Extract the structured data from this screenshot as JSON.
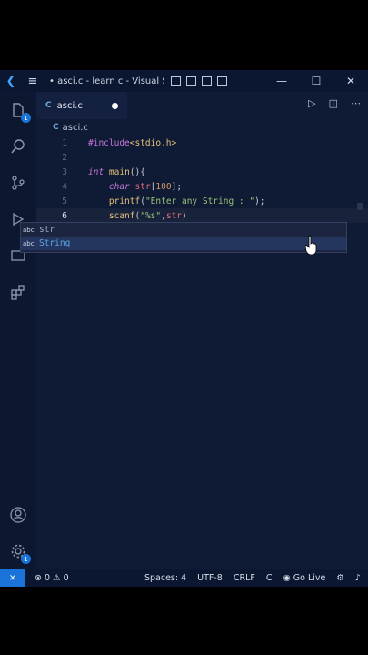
{
  "titlebar": {
    "title": "• asci.c - learn c - Visual St...",
    "minimize": "—",
    "maximize": "☐",
    "close": "✕"
  },
  "activity": {
    "explorer_badge": "1",
    "settings_badge": "1"
  },
  "tab": {
    "icon": "C",
    "label": "asci.c"
  },
  "breadcrumb": {
    "icon": "C",
    "file": "asci.c"
  },
  "editor": {
    "line_numbers": [
      "1",
      "2",
      "3",
      "4",
      "5",
      "6"
    ]
  },
  "suggest": {
    "items": [
      {
        "icon": "abc",
        "label": "str"
      },
      {
        "icon": "abc",
        "label": "String"
      }
    ]
  },
  "statusbar": {
    "problems": "⊗ 0 ⚠ 0",
    "spaces": "Spaces: 4",
    "encoding": "UTF-8",
    "eol": "CRLF",
    "language": "C",
    "golive": "Go Live"
  }
}
